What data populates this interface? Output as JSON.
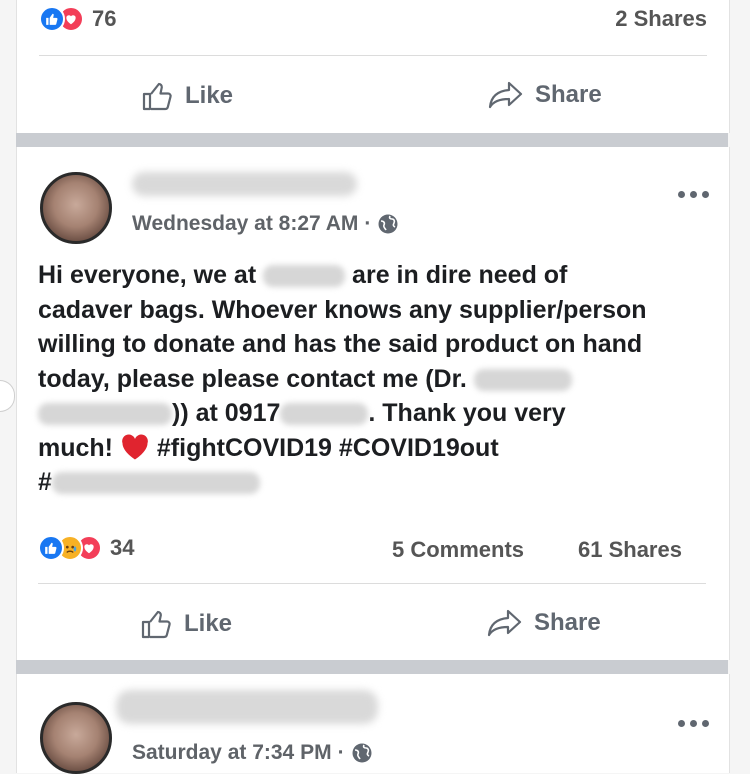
{
  "post1": {
    "reaction_count": "76",
    "shares": "2 Shares",
    "like_label": "Like",
    "share_label": "Share"
  },
  "post2": {
    "timestamp": "Wednesday at 8:27 AM",
    "text": {
      "l1a": "Hi everyone, we at ",
      "l1b": " are in dire need of",
      "l2": "cadaver bags. Whoever knows any supplier/person",
      "l3": "willing to donate and has the said product on hand",
      "l4": "today, please please contact me (Dr. ",
      "l5a": ")) at 0917",
      "l5b": ". Thank you very",
      "l6": "much! ",
      "tag1": "#fightCOVID19",
      "tag2": "#COVID19out",
      "tag3": "#"
    },
    "reaction_count": "34",
    "comments": "5 Comments",
    "shares": "61 Shares",
    "like_label": "Like",
    "share_label": "Share"
  },
  "post3": {
    "timestamp": "Saturday at 7:34 PM"
  },
  "colors": {
    "like_blue": "#1877f2",
    "love_red": "#f33e58",
    "sad_yellow": "#f7b125",
    "separator": "#c9ccd1"
  },
  "icons": [
    "like-reaction-icon",
    "love-reaction-icon",
    "sad-reaction-icon",
    "thumbs-up-icon",
    "share-arrow-icon",
    "globe-icon",
    "more-options-icon",
    "heart-emoji-icon"
  ]
}
